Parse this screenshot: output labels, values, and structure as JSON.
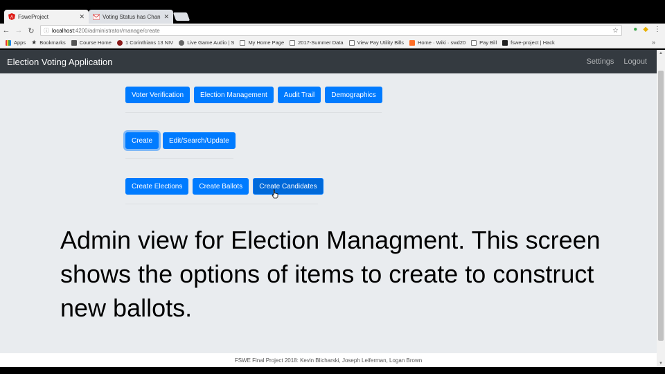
{
  "browser": {
    "tabs": [
      {
        "title": "FsweProject",
        "active": true,
        "icon": "angular-icon"
      },
      {
        "title": "Voting Status has Change",
        "active": false,
        "icon": "gmail-icon"
      }
    ],
    "url_host": "localhost",
    "url_path": ":4200/administrator/manage/create",
    "bookmarks": [
      {
        "label": "Apps",
        "icon": "apps-grid-icon"
      },
      {
        "label": "Bookmarks",
        "icon": "star-icon"
      },
      {
        "label": "Course Home",
        "icon": "course-icon"
      },
      {
        "label": "1 Corinthians 13 NIV",
        "icon": "bible-icon"
      },
      {
        "label": "Live Game Audio | S",
        "icon": "audio-icon"
      },
      {
        "label": "My Home Page",
        "icon": "page-icon"
      },
      {
        "label": "2017-Summer Data",
        "icon": "page-icon"
      },
      {
        "label": "View Pay Utility Bills",
        "icon": "page-icon"
      },
      {
        "label": "Home · Wiki · swd20",
        "icon": "gitlab-icon"
      },
      {
        "label": "Pay Bill",
        "icon": "page-icon"
      },
      {
        "label": "fswe-project | Hack",
        "icon": "hackathon-icon"
      }
    ],
    "bookmarks_more": "»"
  },
  "app": {
    "brand": "Election Voting Application",
    "nav": {
      "settings": "Settings",
      "logout": "Logout"
    },
    "main_menu": [
      "Voter Verification",
      "Election Management",
      "Audit Trail",
      "Demographics"
    ],
    "action_menu": [
      "Create",
      "Edit/Search/Update"
    ],
    "create_menu": [
      "Create Elections",
      "Create Ballots",
      "Create Candidates"
    ],
    "caption": "Admin view for Election Managment. This screen shows the options of items to create to construct new ballots.",
    "footer": "FSWE Final Project 2018: Kevin Blicharski, Joseph Leiferman, Logan Brown"
  },
  "colors": {
    "primary": "#007bff",
    "navbar": "#343a40",
    "background": "#e9ecef"
  }
}
